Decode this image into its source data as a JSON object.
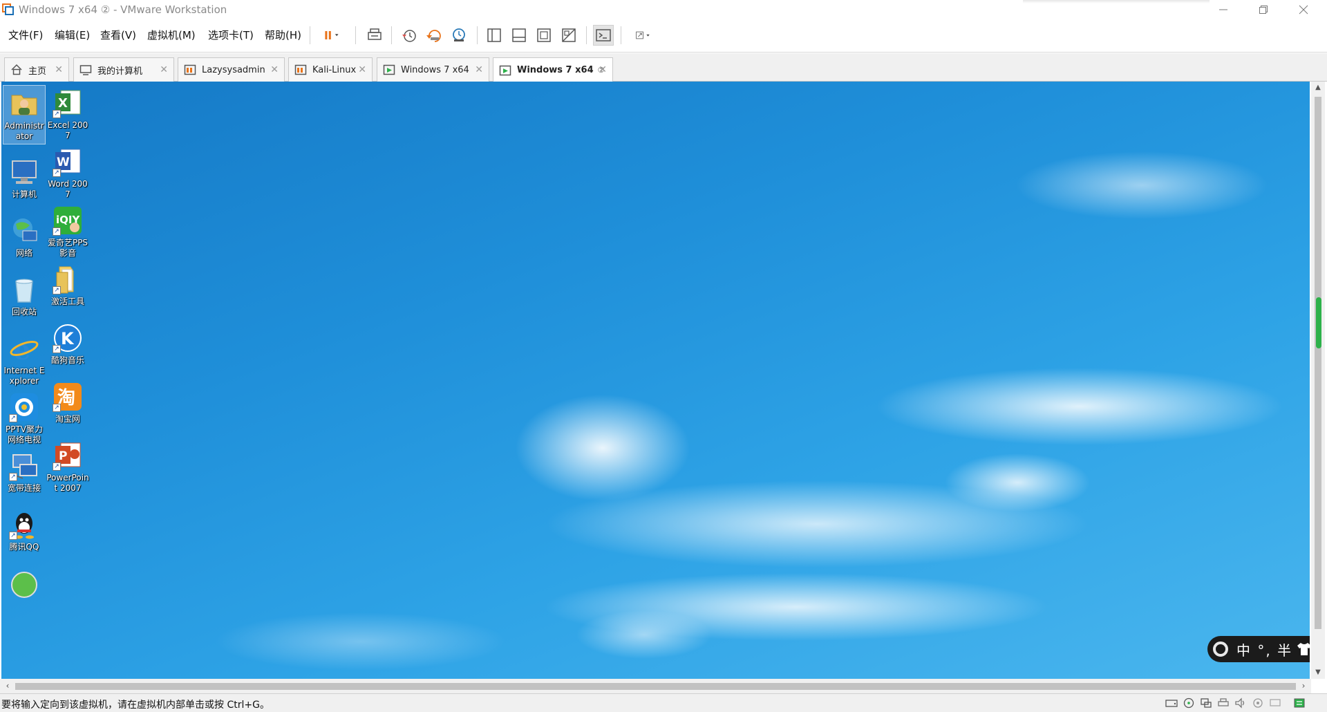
{
  "window": {
    "title": "Windows 7 x64 ② - VMware Workstation"
  },
  "menu": {
    "file": "文件(F)",
    "edit": "编辑(E)",
    "view": "查看(V)",
    "vm": "虚拟机(M)",
    "tabs": "选项卡(T)",
    "help": "帮助(H)"
  },
  "tabs": [
    {
      "label": "主页",
      "icon": "home-icon"
    },
    {
      "label": "我的计算机",
      "icon": "monitor-icon"
    },
    {
      "label": "Lazysysadmin",
      "icon": "vm-icon"
    },
    {
      "label": "Kali-Linux",
      "icon": "vm-icon"
    },
    {
      "label": "Windows 7 x64",
      "icon": "vm-running-icon"
    },
    {
      "label": "Windows 7 x64",
      "icon": "vm-running-icon",
      "active": true,
      "badge": "②"
    }
  ],
  "desktop": {
    "icons": [
      {
        "label": "Administrator",
        "icon": "user-folder-icon"
      },
      {
        "label": "Excel 2007",
        "icon": "excel-icon"
      },
      {
        "label": "计算机",
        "icon": "computer-icon"
      },
      {
        "label": "Word 2007",
        "icon": "word-icon"
      },
      {
        "label": "网络",
        "icon": "network-icon"
      },
      {
        "label": "爱奇艺PPS 影音",
        "icon": "iqiyi-icon"
      },
      {
        "label": "回收站",
        "icon": "recycle-bin-icon"
      },
      {
        "label": "激活工具",
        "icon": "folder-icon"
      },
      {
        "label": "Internet Explorer",
        "icon": "ie-icon"
      },
      {
        "label": "酷狗音乐",
        "icon": "kugou-icon"
      },
      {
        "label": "PPTV聚力 网络电视",
        "icon": "pptv-icon"
      },
      {
        "label": "淘宝网",
        "icon": "taobao-icon"
      },
      {
        "label": "宽带连接",
        "icon": "broadband-icon"
      },
      {
        "label": "PowerPoint 2007",
        "icon": "powerpoint-icon"
      },
      {
        "label": "腾讯QQ",
        "icon": "qq-icon"
      }
    ]
  },
  "ime": {
    "text": "中 °, 半"
  },
  "status": {
    "message": "要将输入定向到该虚拟机，请在虚拟机内部单击或按 Ctrl+G。"
  },
  "colors": {
    "sky_top": "#1579c6",
    "sky_bottom": "#4ab6ee",
    "pause_orange": "#e8731a",
    "progress_green": "#2db14a"
  }
}
